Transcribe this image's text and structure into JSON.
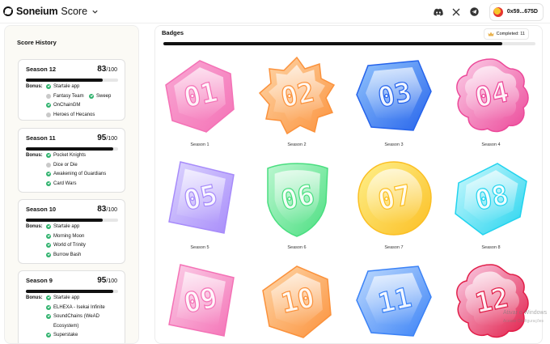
{
  "header": {
    "brand": "Soneium",
    "product": "Score",
    "wallet_address": "0x59...675D",
    "icons": [
      "discord-icon",
      "x-icon",
      "telegram-icon"
    ]
  },
  "score_history": {
    "title": "Score History",
    "seasons": [
      {
        "name": "Season 12",
        "score": "83",
        "max": "/100",
        "progress": 0.83,
        "bonus_label": "Bonus:",
        "bonus": [
          {
            "label": "Startale app",
            "done": true
          },
          {
            "label": "Fantasy Team",
            "done": false
          },
          {
            "label": "Sweep",
            "done": true
          },
          {
            "label": "OnChainGM",
            "done": true
          },
          {
            "label": "Heroes of Hecanos",
            "done": false
          }
        ]
      },
      {
        "name": "Season 11",
        "score": "95",
        "max": "/100",
        "progress": 0.95,
        "bonus_label": "Bonus:",
        "bonus": [
          {
            "label": "Pocket Knights",
            "done": true
          },
          {
            "label": "Dice or Die",
            "done": false
          },
          {
            "label": "Awakening of Guardians",
            "done": true
          },
          {
            "label": "Card Wars",
            "done": true
          }
        ]
      },
      {
        "name": "Season 10",
        "score": "83",
        "max": "/100",
        "progress": 0.83,
        "bonus_label": "Bonus:",
        "bonus": [
          {
            "label": "Startale app",
            "done": true
          },
          {
            "label": "Morning Moon",
            "done": true
          },
          {
            "label": "World of Trinity",
            "done": true
          },
          {
            "label": "Burrow Bash",
            "done": true
          }
        ]
      },
      {
        "name": "Season 9",
        "score": "95",
        "max": "/100",
        "progress": 0.95,
        "bonus_label": "Bonus:",
        "bonus": [
          {
            "label": "Startale app",
            "done": true
          },
          {
            "label": "ELHEXA - Isekai Infinite",
            "done": true
          },
          {
            "label": "SoundChains (WeAD",
            "done": true
          },
          {
            "label": "Ecosystem)",
            "done": null
          },
          {
            "label": "Superstake",
            "done": true
          }
        ]
      }
    ]
  },
  "badges": {
    "title": "Badges",
    "completed": "Completed: 11",
    "progress": 0.91,
    "items": [
      {
        "label": "Season 1",
        "number": "01",
        "c1": "#f9a8d4",
        "c2": "#f472b6",
        "shape": "hexagon"
      },
      {
        "label": "Season 2",
        "number": "02",
        "c1": "#fed7aa",
        "c2": "#fb923c",
        "shape": "star"
      },
      {
        "label": "Season 3",
        "number": "03",
        "c1": "#93c5fd",
        "c2": "#2563eb",
        "shape": "gem"
      },
      {
        "label": "Season 4",
        "number": "04",
        "c1": "#fbcfe8",
        "c2": "#ec4899",
        "shape": "flower"
      },
      {
        "label": "Season 5",
        "number": "05",
        "c1": "#ddd6fe",
        "c2": "#a78bfa",
        "shape": "tilted"
      },
      {
        "label": "Season 6",
        "number": "06",
        "c1": "#bbf7d0",
        "c2": "#4ade80",
        "shape": "shield"
      },
      {
        "label": "Season 7",
        "number": "07",
        "c1": "#fef08a",
        "c2": "#fbbf24",
        "shape": "circle"
      },
      {
        "label": "Season 8",
        "number": "08",
        "c1": "#cffafe",
        "c2": "#22d3ee",
        "shape": "diamond"
      },
      {
        "label": "",
        "number": "09",
        "c1": "#fbcfe8",
        "c2": "#f472b6",
        "shape": "tilted"
      },
      {
        "label": "",
        "number": "10",
        "c1": "#fed7aa",
        "c2": "#fb923c",
        "shape": "hexagon"
      },
      {
        "label": "",
        "number": "11",
        "c1": "#bfdbfe",
        "c2": "#3b82f6",
        "shape": "gem"
      },
      {
        "label": "",
        "number": "12",
        "c1": "#fbcfe8",
        "c2": "#e11d48",
        "shape": "flower"
      }
    ]
  }
}
